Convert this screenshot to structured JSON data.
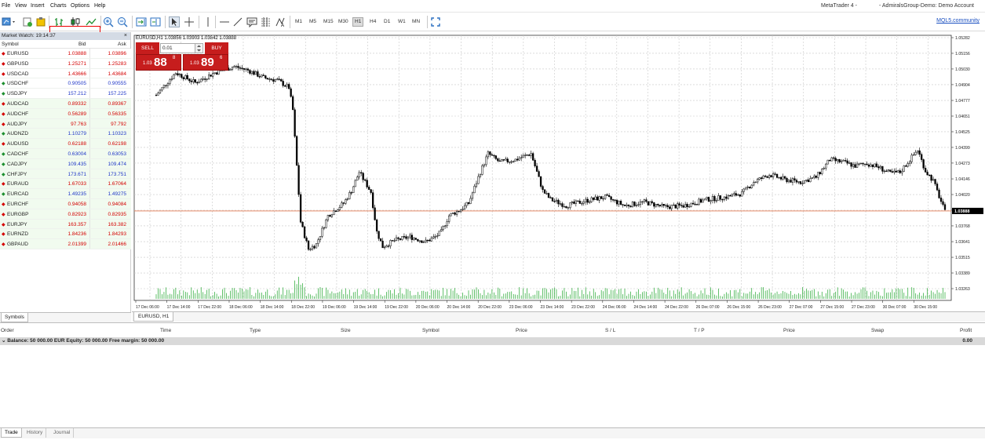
{
  "menu": [
    "File",
    "View",
    "Insert",
    "Charts",
    "Options",
    "Help"
  ],
  "window_title_left": "MetaTrader 4 -",
  "window_title_right": "- AdmiralsGroup-Demo: Demo Account",
  "mql_link": "MQL5.community",
  "timeframes": [
    "M1",
    "M5",
    "M15",
    "M30",
    "H1",
    "H4",
    "D1",
    "W1",
    "MN"
  ],
  "active_timeframe": "H1",
  "market_watch": {
    "title": "Market Watch: 19:14:37",
    "close": "×",
    "col_symbol": "Symbol",
    "col_bid": "Bid",
    "col_ask": "Ask",
    "rows": [
      {
        "s": "EURUSD",
        "b": "1.03888",
        "a": "1.03896",
        "d": "dn"
      },
      {
        "s": "GBPUSD",
        "b": "1.25271",
        "a": "1.25283",
        "d": "dn"
      },
      {
        "s": "USDCAD",
        "b": "1.43666",
        "a": "1.43684",
        "d": "dn"
      },
      {
        "s": "USDCHF",
        "b": "0.90505",
        "a": "0.90555",
        "d": "up"
      },
      {
        "s": "USDJPY",
        "b": "157.212",
        "a": "157.225",
        "d": "up"
      },
      {
        "s": "AUDCAD",
        "b": "0.89332",
        "a": "0.89367",
        "d": "dn"
      },
      {
        "s": "AUDCHF",
        "b": "0.56289",
        "a": "0.56335",
        "d": "dn"
      },
      {
        "s": "AUDJPY",
        "b": "97.763",
        "a": "97.792",
        "d": "dn"
      },
      {
        "s": "AUDNZD",
        "b": "1.10279",
        "a": "1.10323",
        "d": "up"
      },
      {
        "s": "AUDUSD",
        "b": "0.62188",
        "a": "0.62198",
        "d": "dn"
      },
      {
        "s": "CADCHF",
        "b": "0.63004",
        "a": "0.63053",
        "d": "up"
      },
      {
        "s": "CADJPY",
        "b": "109.435",
        "a": "109.474",
        "d": "up"
      },
      {
        "s": "CHFJPY",
        "b": "173.671",
        "a": "173.751",
        "d": "up"
      },
      {
        "s": "EURAUD",
        "b": "1.67033",
        "a": "1.67064",
        "d": "dn"
      },
      {
        "s": "EURCAD",
        "b": "1.49235",
        "a": "1.49275",
        "d": "up"
      },
      {
        "s": "EURCHF",
        "b": "0.94058",
        "a": "0.94084",
        "d": "dn"
      },
      {
        "s": "EURGBP",
        "b": "0.82923",
        "a": "0.82935",
        "d": "dn"
      },
      {
        "s": "EURJPY",
        "b": "163.357",
        "a": "163.382",
        "d": "dn"
      },
      {
        "s": "EURNZD",
        "b": "1.84236",
        "a": "1.84293",
        "d": "dn"
      },
      {
        "s": "GBPAUD",
        "b": "2.01399",
        "a": "2.01466",
        "d": "dn"
      }
    ]
  },
  "symbols_tab": "Symbols",
  "chart": {
    "header": "EURUSD,H1  1.03856 1.03903 1.03842 1.03888",
    "tab": "EURUSD, H1",
    "current_price": "1.03888",
    "y_ticks": [
      "1.05282",
      "1.05156",
      "1.05030",
      "1.04904",
      "1.04777",
      "1.04651",
      "1.04525",
      "1.04399",
      "1.04273",
      "1.04146",
      "1.04020",
      "1.03894",
      "1.03768",
      "1.03641",
      "1.03515",
      "1.03389",
      "1.03263"
    ],
    "x_ticks": [
      "17 Dec 06:00",
      "17 Dec 14:00",
      "17 Dec 22:00",
      "18 Dec 06:00",
      "18 Dec 14:00",
      "18 Dec 22:00",
      "19 Dec 06:00",
      "19 Dec 14:00",
      "19 Dec 22:00",
      "20 Dec 06:00",
      "20 Dec 14:00",
      "20 Dec 22:00",
      "23 Dec 06:00",
      "23 Dec 14:00",
      "23 Dec 22:00",
      "24 Dec 06:00",
      "24 Dec 14:00",
      "24 Dec 22:00",
      "26 Dec 07:00",
      "26 Dec 15:00",
      "26 Dec 23:00",
      "27 Dec 07:00",
      "27 Dec 15:00",
      "27 Dec 23:00",
      "30 Dec 07:00",
      "30 Dec 15:00"
    ]
  },
  "one_click": {
    "sell": "SELL",
    "buy": "BUY",
    "lots": "0.01",
    "sell_big": "1.03",
    "sell_pips": "88",
    "sell_frac": "8",
    "buy_big": "1.03",
    "buy_pips": "89",
    "buy_frac": "6"
  },
  "terminal": {
    "cols": [
      "Order",
      "Time",
      "Type",
      "Size",
      "Symbol",
      "Price",
      "S / L",
      "T / P",
      "Price",
      "Swap",
      "Profit"
    ],
    "balance": "Balance: 50 000.00 EUR  Equity: 50 000.00  Free margin: 50 000.00",
    "profit": "0.00",
    "tabs": [
      "Trade",
      "History",
      "Journal"
    ]
  }
}
